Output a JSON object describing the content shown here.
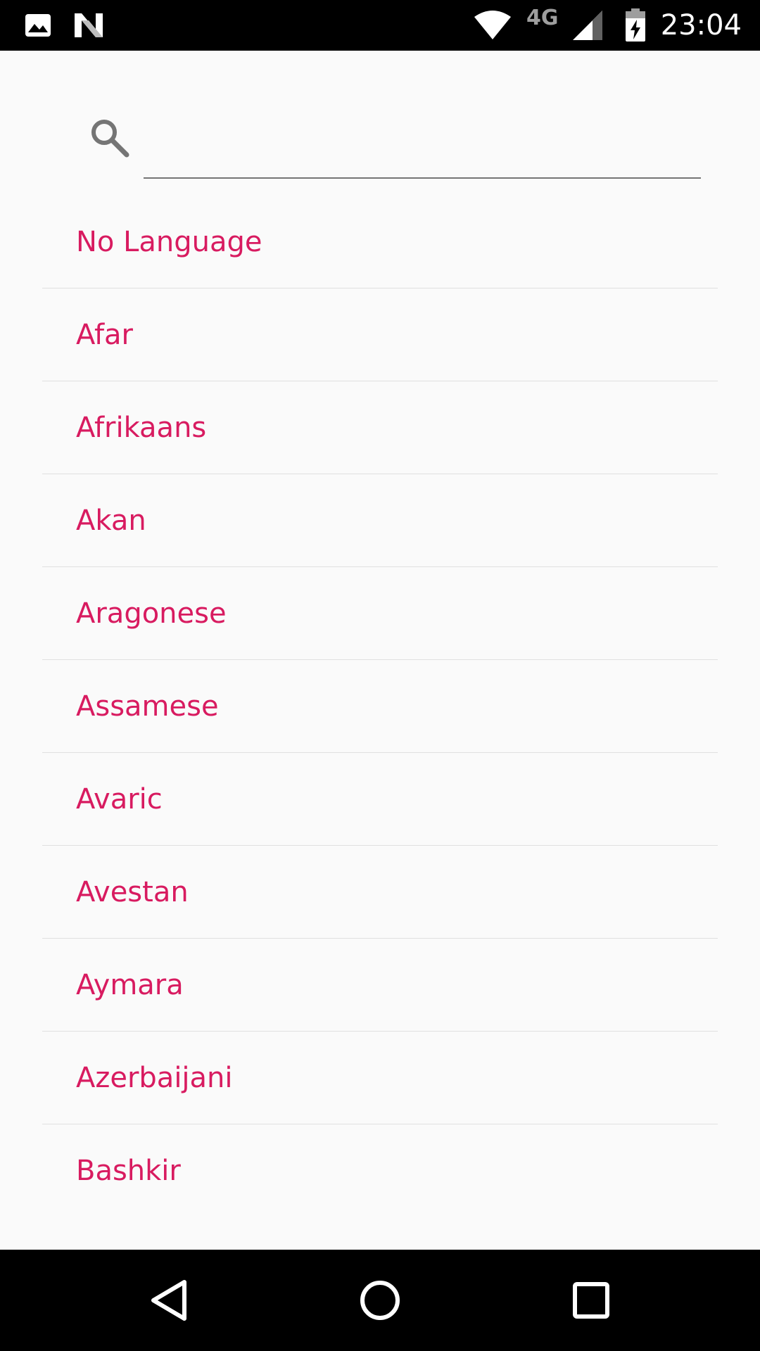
{
  "status_bar": {
    "time": "23:04",
    "network_label": "4G",
    "icons": [
      "image-icon",
      "n-icon",
      "wifi-icon",
      "signal-icon",
      "battery-charging-icon"
    ]
  },
  "search": {
    "value": "",
    "placeholder": "",
    "icon": "search-icon"
  },
  "languages": [
    "No Language",
    "Afar",
    "Afrikaans",
    "Akan",
    "Aragonese",
    "Assamese",
    "Avaric",
    "Avestan",
    "Aymara",
    "Azerbaijani",
    "Bashkir"
  ],
  "nav_bar": {
    "icons": [
      "back-icon",
      "home-icon",
      "recents-icon"
    ]
  },
  "colors": {
    "accent": "#d81b60",
    "background": "#fafafa",
    "divider": "#e0e0e0"
  }
}
